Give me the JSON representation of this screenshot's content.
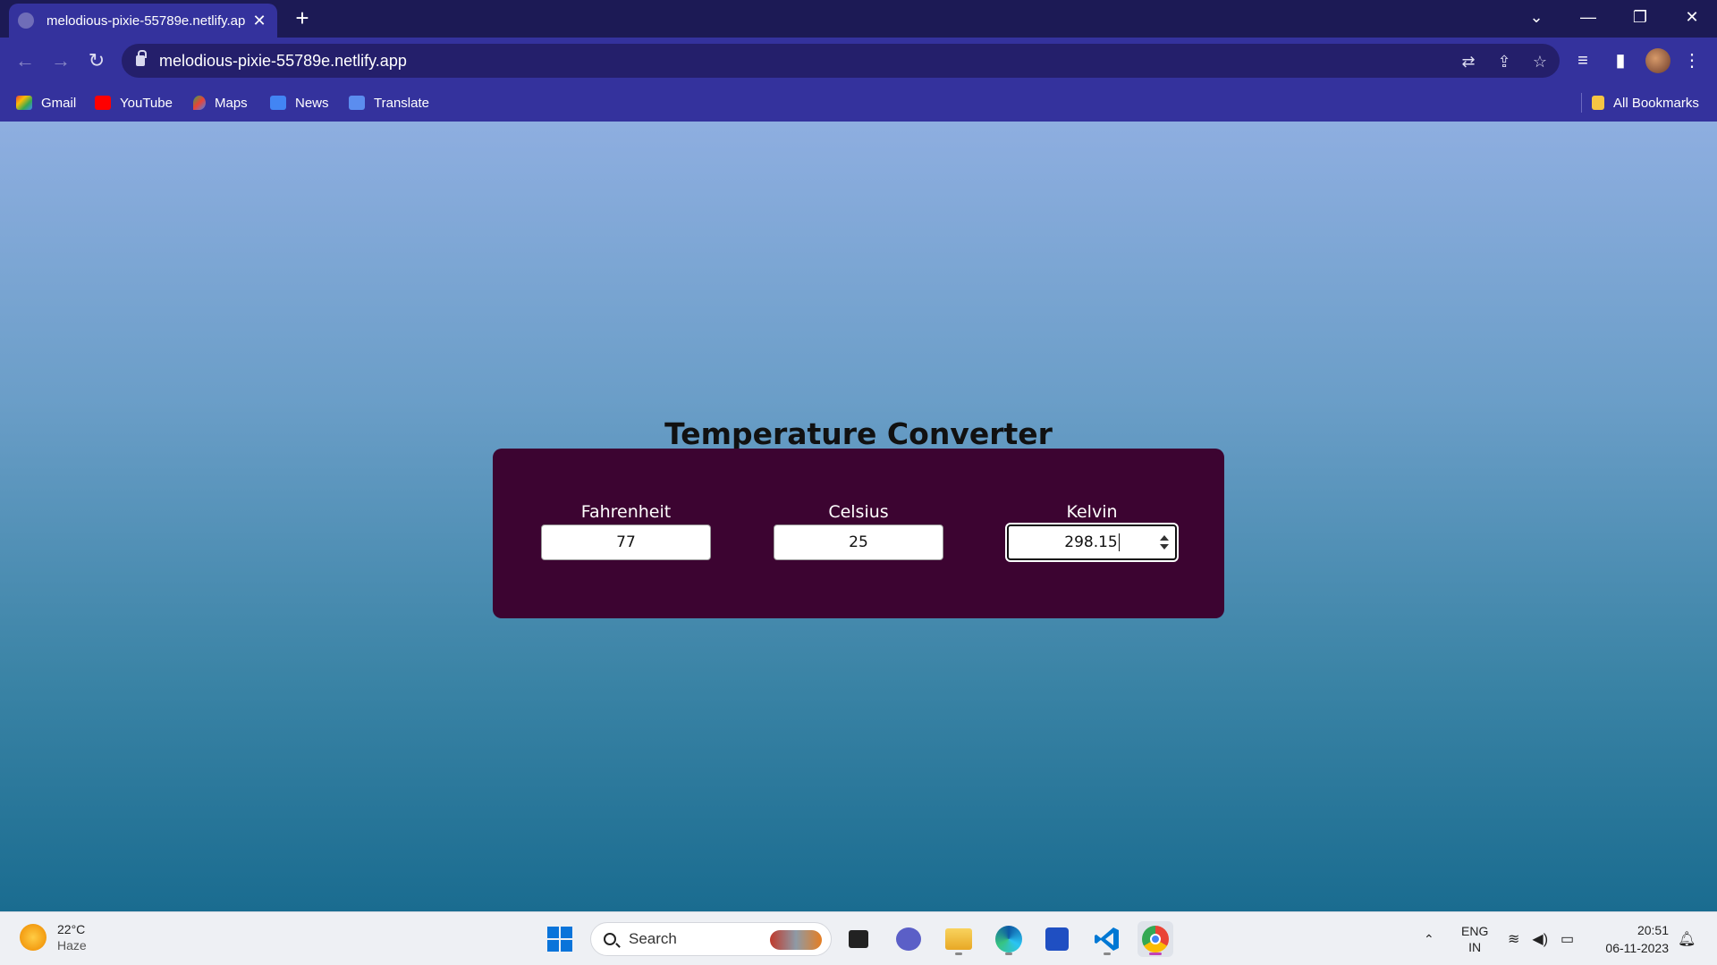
{
  "browser": {
    "tab_title": "melodious-pixie-55789e.netlify.app",
    "url": "melodious-pixie-55789e.netlify.app",
    "bookmarks": [
      "Gmail",
      "YouTube",
      "Maps",
      "News",
      "Translate"
    ],
    "all_bookmarks": "All Bookmarks",
    "theme_color": "#34329d"
  },
  "page": {
    "title": "Temperature Converter",
    "card_color": "#3c0431",
    "fields": {
      "fahrenheit": {
        "label": "Fahrenheit",
        "value": "77"
      },
      "celsius": {
        "label": "Celsius",
        "value": "25"
      },
      "kelvin": {
        "label": "Kelvin",
        "value": "298.15"
      }
    }
  },
  "taskbar": {
    "weather_temp": "22°C",
    "weather_desc": "Haze",
    "search_placeholder": "Search",
    "lang_top": "ENG",
    "lang_bottom": "IN",
    "time": "20:51",
    "date": "06-11-2023"
  }
}
